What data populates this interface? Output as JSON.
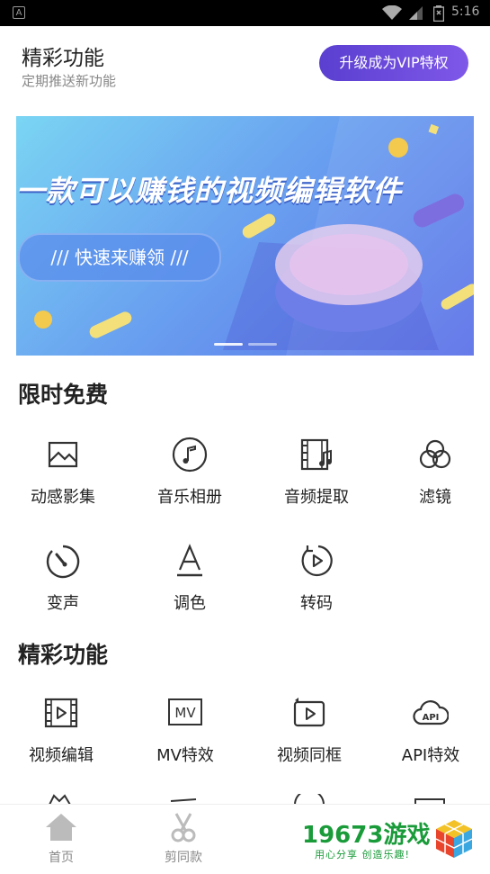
{
  "status_bar": {
    "time": "5:16",
    "app_badge": "A"
  },
  "header": {
    "title": "精彩功能",
    "subtitle": "定期推送新功能",
    "vip_button": "升级成为VIP特权"
  },
  "banner": {
    "headline": "一款可以赚钱的视频编辑软件",
    "pill": "/// 快速来赚领 ///"
  },
  "sections": [
    {
      "title": "限时免费",
      "items": [
        {
          "label": "动感影集",
          "icon": "photo-album-icon"
        },
        {
          "label": "音乐相册",
          "icon": "music-note-icon"
        },
        {
          "label": "音频提取",
          "icon": "audio-extract-icon"
        },
        {
          "label": "滤镜",
          "icon": "filter-icon"
        },
        {
          "label": "变声",
          "icon": "voice-change-icon"
        },
        {
          "label": "调色",
          "icon": "color-adjust-icon"
        },
        {
          "label": "转码",
          "icon": "transcode-icon"
        }
      ]
    },
    {
      "title": "精彩功能",
      "items": [
        {
          "label": "视频编辑",
          "icon": "video-edit-icon"
        },
        {
          "label": "MV特效",
          "icon": "mv-icon"
        },
        {
          "label": "视频同框",
          "icon": "video-duet-icon"
        },
        {
          "label": "API特效",
          "icon": "api-cloud-icon"
        }
      ]
    }
  ],
  "tabbar": {
    "tabs": [
      {
        "label": "首页",
        "icon": "home-icon"
      },
      {
        "label": "剪同款",
        "icon": "scissors-icon"
      }
    ]
  },
  "watermark": {
    "number": "19673游戏",
    "slogan": "用心分享 创造乐趣!"
  }
}
